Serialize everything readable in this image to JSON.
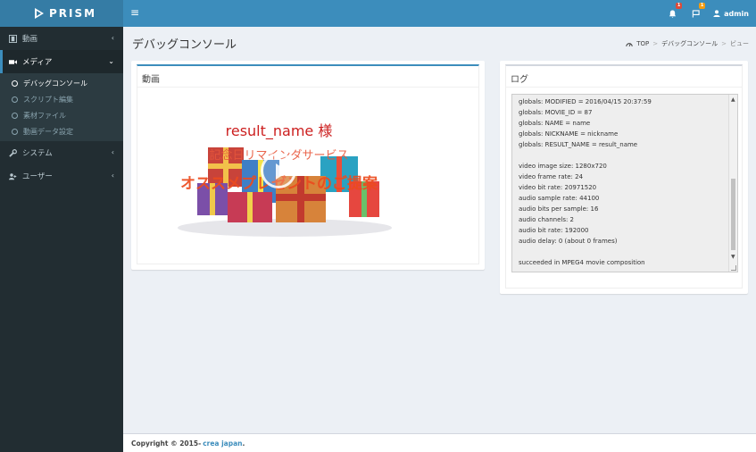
{
  "app": {
    "logo_text": "PRISM"
  },
  "header": {
    "user_name": "admin",
    "notif_count": "1",
    "flag_count": "1"
  },
  "sidebar": {
    "items": [
      {
        "label": "動画"
      },
      {
        "label": "メディア"
      },
      {
        "label": "システム"
      },
      {
        "label": "ユーザー"
      }
    ],
    "media_sub": [
      {
        "label": "デバッグコンソール"
      },
      {
        "label": "スクリプト編集"
      },
      {
        "label": "素材ファイル"
      },
      {
        "label": "動画データ設定"
      }
    ]
  },
  "page": {
    "title": "デバッグコンソール",
    "breadcrumb": [
      "TOP",
      "デバッグコンソール",
      "ビュー"
    ]
  },
  "video_box": {
    "title": "動画",
    "overlay_title": "result_name 様",
    "overlay_sub1": "記念日リマインダサービス",
    "overlay_sub2": "オススメプレゼントのご提案"
  },
  "log_box": {
    "title": "ログ",
    "lines": [
      "globals: MODIFIED = 2016/04/15 20:37:59",
      "globals: MOVIE_ID = 87",
      "globals: NAME = name",
      "globals: NICKNAME = nickname",
      "globals: RESULT_NAME = result_name",
      "",
      "video image size: 1280x720",
      "video frame rate: 24",
      "video bit rate: 20971520",
      "audio sample rate: 44100",
      "audio bits per sample: 16",
      "audio channels: 2",
      "audio bit rate: 192000",
      "audio delay: 0 (about 0 frames)",
      "",
      "succeeded in MPEG4 movie composition"
    ]
  },
  "footer": {
    "copyright": "Copyright © 2015-",
    "company": "crea japan",
    "period": "."
  }
}
